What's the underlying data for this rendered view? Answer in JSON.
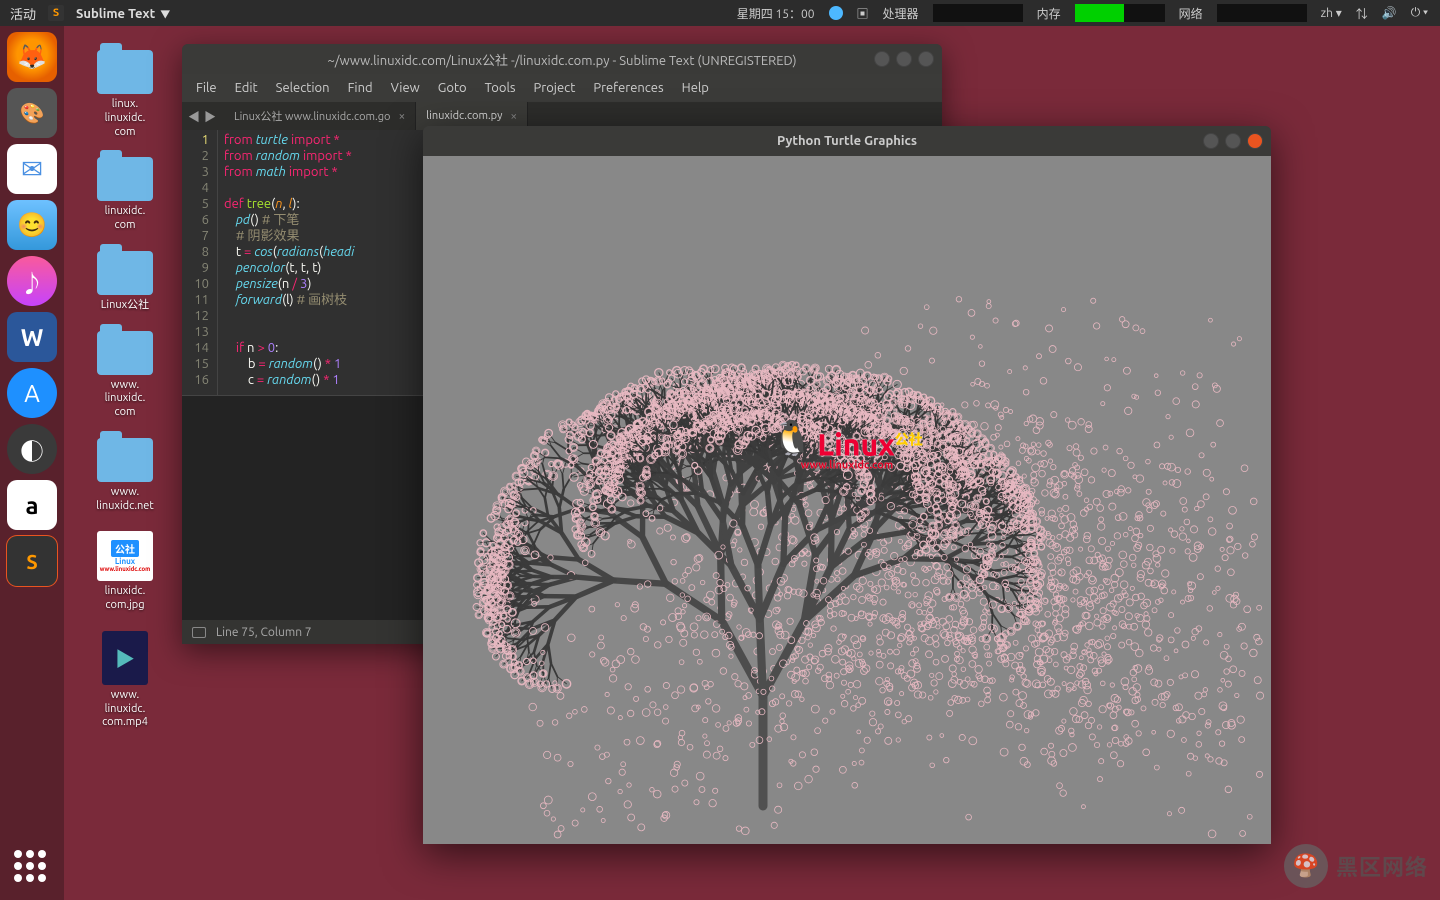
{
  "topbar": {
    "activities": "活动",
    "app_name": "Sublime Text",
    "datetime": "星期四 15：00",
    "cpu_label": "处理器",
    "mem_label": "内存",
    "net_label": "网络",
    "lang": "zh"
  },
  "dock": {
    "apps": [
      "firefox",
      "gimp",
      "mail",
      "finder",
      "music",
      "word",
      "appstore",
      "spinner",
      "amazon",
      "sublime"
    ]
  },
  "desktop": {
    "icons": [
      {
        "type": "folder",
        "label": "linux.\nlinuxidc.\ncom"
      },
      {
        "type": "folder",
        "label": "linuxidc.\ncom"
      },
      {
        "type": "folder",
        "label": "Linux公社"
      },
      {
        "type": "folder",
        "label": "www.\nlinuxidc.\ncom"
      },
      {
        "type": "folder",
        "label": "www.\nlinuxidc.net"
      },
      {
        "type": "image",
        "label": "linuxidc.\ncom.jpg"
      },
      {
        "type": "video",
        "label": "www.\nlinuxidc.\ncom.mp4"
      }
    ]
  },
  "sublime": {
    "title": "~/www.linuxidc.com/Linux公社 -/linuxidc.com.py - Sublime Text (UNREGISTERED)",
    "menu": [
      "File",
      "Edit",
      "Selection",
      "Find",
      "View",
      "Goto",
      "Tools",
      "Project",
      "Preferences",
      "Help"
    ],
    "tabs": [
      {
        "label": "Linux公社 www.linuxidc.com.go",
        "active": false
      },
      {
        "label": "linuxidc.com.py",
        "active": true
      }
    ],
    "status": "Line 75, Column 7",
    "code_lines": [
      {
        "n": 1,
        "html": "<span class='kw'>from</span> <span class='fn'>turtle</span> <span class='kw'>import</span> <span class='op'>*</span>"
      },
      {
        "n": 2,
        "html": "<span class='kw'>from</span> <span class='fn'>random</span> <span class='kw'>import</span> <span class='op'>*</span>"
      },
      {
        "n": 3,
        "html": "<span class='kw'>from</span> <span class='fn'>math</span> <span class='kw'>import</span> <span class='op'>*</span>"
      },
      {
        "n": 4,
        "html": ""
      },
      {
        "n": 5,
        "html": "<span class='kw'>def</span> <span class='nm'>tree</span>(<span class='pn'>n</span>, <span class='pn'>l</span>):"
      },
      {
        "n": 6,
        "html": "    <span class='fn'>pd</span>() <span class='cm'># 下笔</span>"
      },
      {
        "n": 7,
        "html": "    <span class='cm'># 阴影效果</span>"
      },
      {
        "n": 8,
        "html": "    t <span class='op'>=</span> <span class='fn'>cos</span>(<span class='fn'>radians</span>(<span class='fn'>headi</span>"
      },
      {
        "n": 9,
        "html": "    <span class='fn'>pencolor</span>(t, t, t)"
      },
      {
        "n": 10,
        "html": "    <span class='fn'>pensize</span>(n <span class='op'>/</span> <span class='num'>3</span>)"
      },
      {
        "n": 11,
        "html": "    <span class='fn'>forward</span>(l) <span class='cm'># 画树枝</span>"
      },
      {
        "n": 12,
        "html": ""
      },
      {
        "n": 13,
        "html": ""
      },
      {
        "n": 14,
        "html": "    <span class='kw'>if</span> n <span class='op'>&gt;</span> <span class='num'>0</span>:"
      },
      {
        "n": 15,
        "html": "        b <span class='op'>=</span> <span class='fn'>random</span>() <span class='op'>*</span> <span class='num'>1</span>"
      },
      {
        "n": 16,
        "html": "        c <span class='op'>=</span> <span class='fn'>random</span>() <span class='op'>*</span> <span class='num'>1</span>"
      }
    ]
  },
  "turtle": {
    "title": "Python Turtle Graphics",
    "watermark_text": "Linux",
    "watermark_cn": "公社",
    "watermark_url": "www.linuxidc.com"
  },
  "br_watermark": "黑区网络"
}
